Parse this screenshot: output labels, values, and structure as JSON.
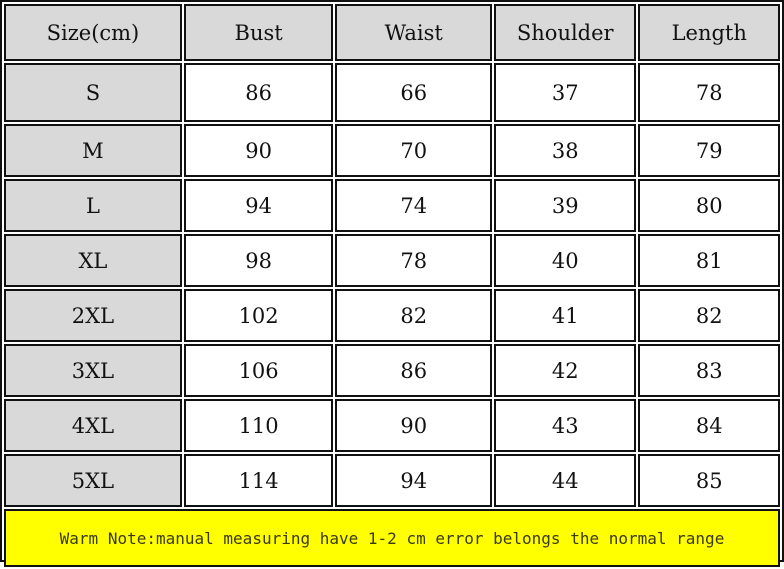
{
  "headers": [
    "Size(cm)",
    "Bust",
    "Waist",
    "Shoulder",
    "Length"
  ],
  "rows": [
    [
      "S",
      "86",
      "66",
      "37",
      "78"
    ],
    [
      "M",
      "90",
      "70",
      "38",
      "79"
    ],
    [
      "L",
      "94",
      "74",
      "39",
      "80"
    ],
    [
      "XL",
      "98",
      "78",
      "40",
      "81"
    ],
    [
      "2XL",
      "102",
      "82",
      "41",
      "82"
    ],
    [
      "3XL",
      "106",
      "86",
      "42",
      "83"
    ],
    [
      "4XL",
      "110",
      "90",
      "43",
      "84"
    ],
    [
      "5XL",
      "114",
      "94",
      "44",
      "85"
    ]
  ],
  "note": "Warm Note:manual measuring have 1-2 cm error belongs the normal range",
  "colors": {
    "header_bg": "#d9d9d9",
    "note_bg": "#ffff00",
    "border": "#111111"
  }
}
